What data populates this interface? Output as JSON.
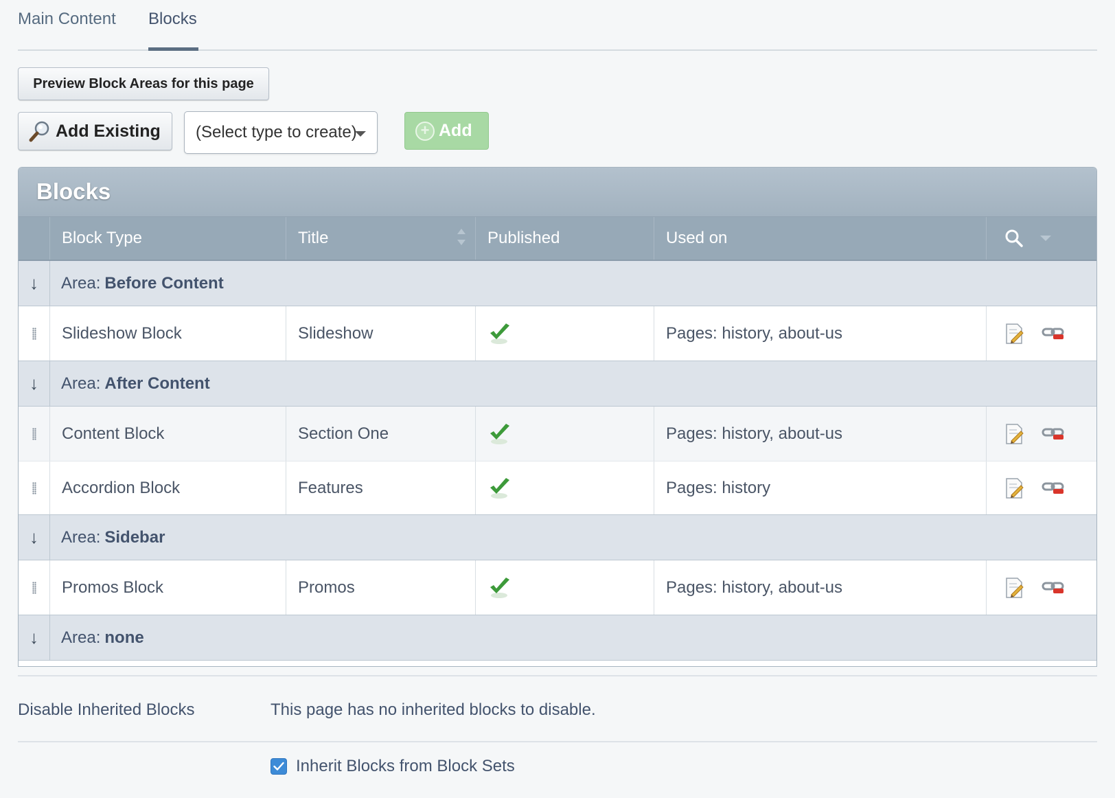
{
  "tabs": [
    {
      "label": "Main Content"
    },
    {
      "label": "Blocks"
    }
  ],
  "toolbar": {
    "preview_label": "Preview Block Areas for this page",
    "add_existing_label": "Add Existing",
    "select_value": "(Select type to create)",
    "add_label": "Add"
  },
  "grid": {
    "title": "Blocks",
    "columns": [
      "Block Type",
      "Title",
      "Published",
      "Used on"
    ],
    "areas": [
      {
        "prefix": "Area:",
        "name": "Before Content",
        "rows": [
          {
            "type": "Slideshow Block",
            "title": "Slideshow",
            "used_on": "Pages: history, about-us"
          }
        ]
      },
      {
        "prefix": "Area:",
        "name": "After Content",
        "rows": [
          {
            "type": "Content Block",
            "title": "Section One",
            "used_on": "Pages: history, about-us"
          },
          {
            "type": "Accordion Block",
            "title": "Features",
            "used_on": "Pages: history"
          }
        ]
      },
      {
        "prefix": "Area:",
        "name": "Sidebar",
        "rows": [
          {
            "type": "Promos Block",
            "title": "Promos",
            "used_on": "Pages: history, about-us"
          }
        ]
      },
      {
        "prefix": "Area:",
        "name": "none",
        "rows": []
      }
    ],
    "area_arrow": "↓"
  },
  "footer": {
    "disable_label": "Disable Inherited Blocks",
    "disable_text": "This page has no inherited blocks to disable.",
    "inherit_label": "Inherit Blocks from Block Sets",
    "inherit_checked": true
  },
  "colors": {
    "check_green": "#3d9a3a",
    "header_bg": "#97a9b7",
    "area_bg": "#dde3ea",
    "add_button": "#a8d9a4",
    "checkbox_blue": "#3d8bd7"
  }
}
